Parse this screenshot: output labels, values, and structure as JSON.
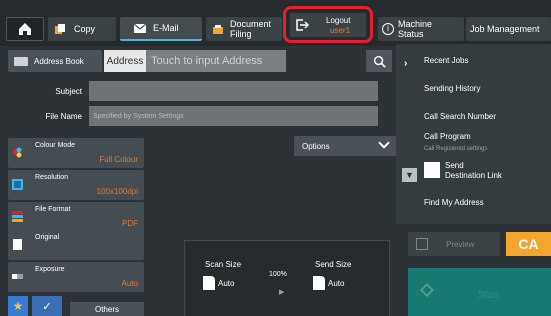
{
  "topbar": {
    "copy_label": "Copy",
    "email_label": "E-Mail",
    "docfiling_label_1": "Document",
    "docfiling_label_2": "Filing",
    "logout_label": "Logout",
    "logout_user": "user1",
    "machine_label_1": "Machine",
    "machine_label_2": "Status",
    "job_label": "Job Management"
  },
  "address": {
    "book_label": "Address Book",
    "label": "Address",
    "placeholder": "Touch to input Address"
  },
  "fields": {
    "subject_label": "Subject",
    "filename_label": "File Name",
    "filename_placeholder": "Specified by System Settings"
  },
  "options_label": "Options",
  "right_menu": {
    "recent_jobs": "Recent Jobs",
    "sending_history": "Sending History",
    "call_search_number": "Call Search Number",
    "call_program": "Call Program",
    "call_program_sub": "Call Registered settings",
    "send_destination_1": "Send",
    "send_destination_2": "Destination Link",
    "find_my_address": "Find My Address"
  },
  "settings": {
    "colour_mode_label": "Colour Mode",
    "colour_mode_value": "Full Colour",
    "resolution_label": "Resolution",
    "resolution_value": "100x100dpi",
    "file_format_label": "File Format",
    "file_format_value": "PDF",
    "original_label": "Original",
    "exposure_label": "Exposure",
    "exposure_value": "Auto"
  },
  "scan_panel": {
    "scan_size_label": "Scan Size",
    "scan_size_value": "Auto",
    "send_size_label": "Send Size",
    "send_size_value": "Auto",
    "ratio": "100%"
  },
  "bottom": {
    "others_label": "Others",
    "preview_label": "Preview",
    "ca_label": "CA",
    "start_label": "Start"
  },
  "colors": {
    "accent_orange": "#e07a35",
    "highlight_red": "#e4202e",
    "ca_orange": "#f3a52e",
    "start_teal": "#17796f"
  }
}
